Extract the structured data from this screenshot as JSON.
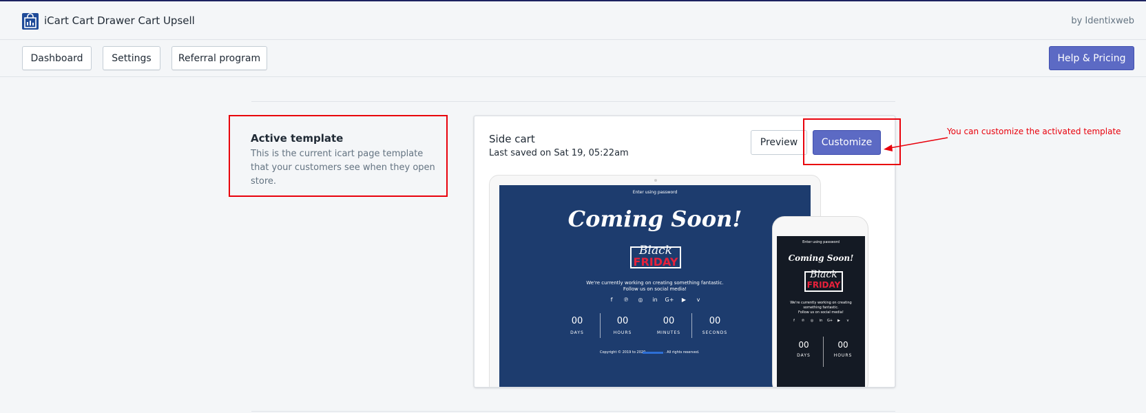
{
  "app": {
    "title": "iCart Cart Drawer Cart Upsell",
    "byline": "by Identixweb",
    "logo_icon": "shopping-bag-icon"
  },
  "nav": {
    "buttons": [
      "Dashboard",
      "Settings",
      "Referral program"
    ],
    "help_label": "Help & Pricing"
  },
  "section": {
    "title": "Active template",
    "description": "This is the current icart page template that your customers see when they open store."
  },
  "card": {
    "title": "Side cart",
    "last_saved": "Last saved on Sat 19, 05:22am",
    "preview_label": "Preview",
    "customize_label": "Customize"
  },
  "template_preview": {
    "enter_password": "Enter using password",
    "heading": "Coming Soon!",
    "badge_top": "Black",
    "badge_bottom": "FRIDAY",
    "message_line1": "We're currently working on creating something fantastic.",
    "message_line2": "Follow us on social media!",
    "phone_message_line1": "We're currently working on creating something fantastic.",
    "phone_message_line2": "Follow us on social media!",
    "social_icons": [
      "f",
      "℗",
      "◎",
      "in",
      "G+",
      "▶",
      "v"
    ],
    "countdown": [
      {
        "value": "00",
        "label": "DAYS"
      },
      {
        "value": "00",
        "label": "HOURS"
      },
      {
        "value": "00",
        "label": "MINUTES"
      },
      {
        "value": "00",
        "label": "SECONDS"
      }
    ],
    "copyright_prefix": "Copyright © 2019 to 2020,",
    "copyright_suffix": ". All rights reserved."
  },
  "annotation": {
    "text": "You can customize the activated template",
    "color": "#e8000b"
  },
  "colors": {
    "accent": "#5c6ac4",
    "screen_bg": "#1d3c6e",
    "phone_bg": "#141a24",
    "friday_red": "#e8213b"
  }
}
